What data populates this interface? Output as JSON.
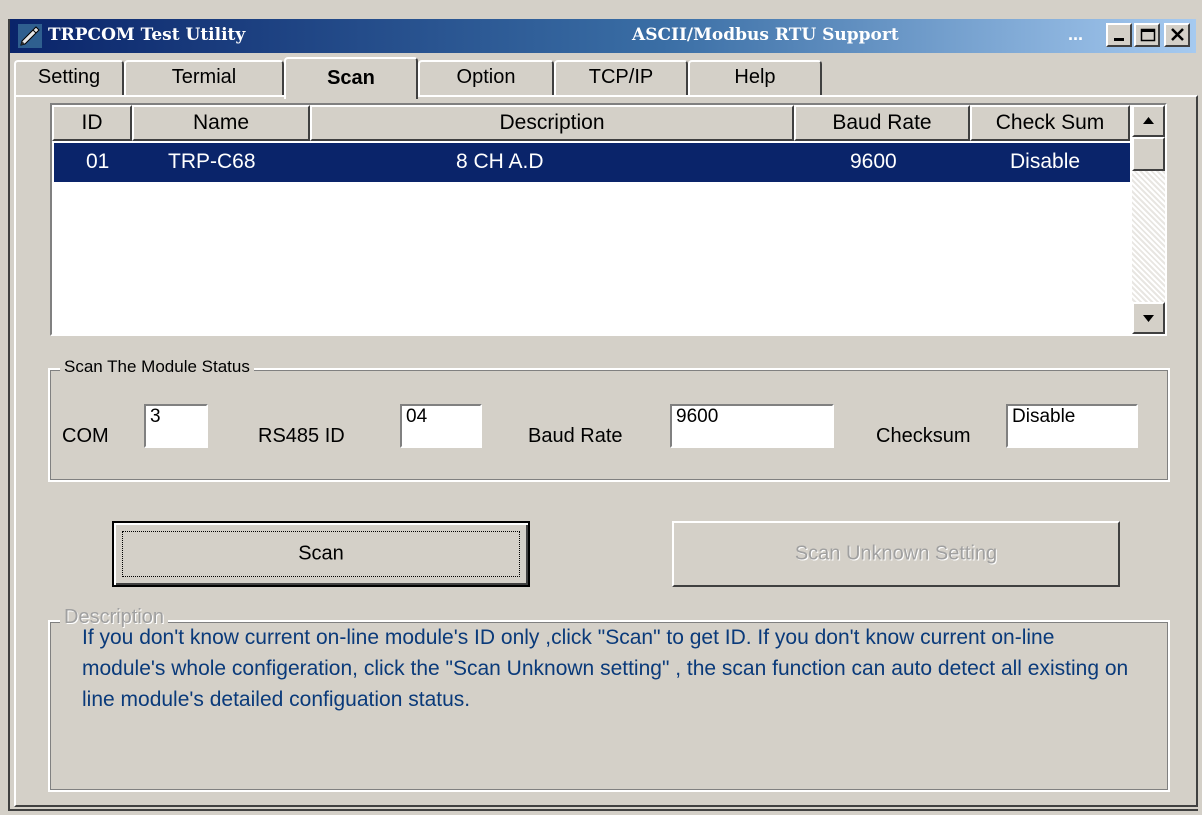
{
  "window": {
    "title": "TRPCOM Test Utility",
    "subtitle": "ASCII/Modbus RTU Support",
    "ellipsis": "...",
    "minimize_icon": "minimize-icon",
    "maximize_icon": "maximize-icon",
    "close_icon": "close-icon",
    "app_icon": "pen-icon"
  },
  "tabs": [
    {
      "label": "Setting",
      "active": false
    },
    {
      "label": "Termial",
      "active": false
    },
    {
      "label": "Scan",
      "active": true
    },
    {
      "label": "Option",
      "active": false
    },
    {
      "label": "TCP/IP",
      "active": false
    },
    {
      "label": "Help",
      "active": false
    }
  ],
  "module_list": {
    "columns": [
      "ID",
      "Name",
      "Description",
      "Baud Rate",
      "Check Sum"
    ],
    "rows": [
      {
        "id": "01",
        "name": "TRP-C68",
        "description": "8 CH A.D",
        "baud_rate": "9600",
        "check_sum": "Disable",
        "selected": true
      }
    ]
  },
  "scan_status": {
    "legend": "Scan The Module Status",
    "com_label": "COM",
    "com_value": "3",
    "rs485_label": "RS485 ID",
    "rs485_value": "04",
    "baud_label": "Baud Rate",
    "baud_value": "9600",
    "checksum_label": "Checksum",
    "checksum_value": "Disable"
  },
  "buttons": {
    "scan": "Scan",
    "scan_unknown": "Scan Unknown Setting"
  },
  "description": {
    "legend": "Description",
    "text": "If you don't know current on-line module's ID only ,click \"Scan\" to get ID. If you don't know current on-line module's whole configeration, click the \"Scan Unknown setting\" , the scan function can auto detect all existing on line module's  detailed configuation status."
  },
  "colors": {
    "face": "#d4d0c8",
    "selection": "#0a246a",
    "description_text": "#0a3a7a"
  }
}
